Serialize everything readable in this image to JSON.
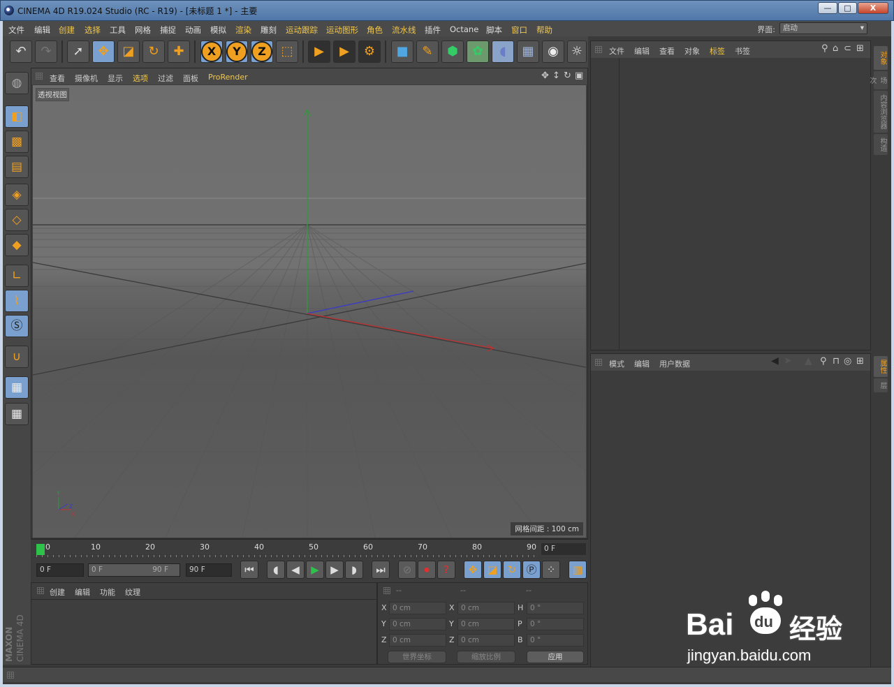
{
  "window": {
    "title": "CINEMA 4D R19.024 Studio (RC - R19) - [未标题 1 *] - 主要",
    "controls": {
      "minimize": "—",
      "maximize": "□",
      "close": "X"
    }
  },
  "menubar": {
    "items": [
      "文件",
      "编辑",
      "创建",
      "选择",
      "工具",
      "网格",
      "捕捉",
      "动画",
      "模拟",
      "渲染",
      "雕刻",
      "运动跟踪",
      "运动图形",
      "角色",
      "流水线",
      "插件",
      "Octane",
      "脚本",
      "窗口",
      "帮助"
    ],
    "layout_label": "界面:",
    "layout_value": "启动"
  },
  "toolbar": {
    "icons": [
      "undo-icon",
      "redo-icon",
      "live-select-icon",
      "move-icon",
      "scale-icon",
      "rotate-icon",
      "transform-icon",
      "x-axis-icon",
      "y-axis-icon",
      "z-axis-icon",
      "coordinate-system-icon",
      "render-view-icon",
      "render-to-picture-viewer-icon",
      "render-settings-icon",
      "cube-icon",
      "pen-icon",
      "subdivision-icon",
      "cloner-icon",
      "deformer-icon",
      "floor-icon",
      "camera-icon",
      "light-icon"
    ],
    "axis_labels": {
      "x": "X",
      "y": "Y",
      "z": "Z"
    }
  },
  "viewport_menu": {
    "items": [
      "查看",
      "摄像机",
      "显示",
      "选项",
      "过滤",
      "面板",
      "ProRender"
    ]
  },
  "viewport": {
    "label": "透视视图",
    "grid_info": "网格间距 : 100 cm",
    "axis_mini": {
      "y": "Y",
      "x": "X",
      "z": "Z"
    }
  },
  "timeline": {
    "ticks": [
      "0",
      "10",
      "20",
      "30",
      "40",
      "50",
      "60",
      "70",
      "80",
      "90"
    ],
    "current_frame": "0 F"
  },
  "transport": {
    "start_field": "0 F",
    "range_start": "0 F",
    "range_end": "90 F",
    "end_field": "90 F"
  },
  "material_panel": {
    "menu": [
      "创建",
      "编辑",
      "功能",
      "纹理"
    ]
  },
  "coord_panel": {
    "headers": [
      "--",
      "--",
      "--"
    ],
    "rows": [
      {
        "l1": "X",
        "v1": "0 cm",
        "l2": "X",
        "v2": "0 cm",
        "l3": "H",
        "v3": "0 °"
      },
      {
        "l1": "Y",
        "v1": "0 cm",
        "l2": "Y",
        "v2": "0 cm",
        "l3": "P",
        "v3": "0 °"
      },
      {
        "l1": "Z",
        "v1": "0 cm",
        "l2": "Z",
        "v2": "0 cm",
        "l3": "B",
        "v3": "0 °"
      }
    ],
    "world_dropdown": "世界坐标",
    "scale_dropdown": "缩放比例",
    "apply_button": "应用"
  },
  "object_panel": {
    "menu": [
      "文件",
      "编辑",
      "查看",
      "对象",
      "标签",
      "书签"
    ]
  },
  "attribute_panel": {
    "menu": [
      "模式",
      "编辑",
      "用户数据"
    ]
  },
  "right_tabs": {
    "top": [
      "对象",
      "场次",
      "内容浏览器",
      "构造"
    ],
    "bottom": [
      "属性",
      "层"
    ]
  },
  "branding": {
    "maxon": "MAXON",
    "cinema": "CINEMA 4D",
    "watermark_brand": "Bai",
    "watermark_du": "du",
    "watermark_cn": "经验",
    "watermark_url": "jingyan.baidu.com"
  },
  "colors": {
    "accent": "#f0a020",
    "highlight_text": "#f2c84a",
    "active_blue": "#7aa0cf"
  }
}
